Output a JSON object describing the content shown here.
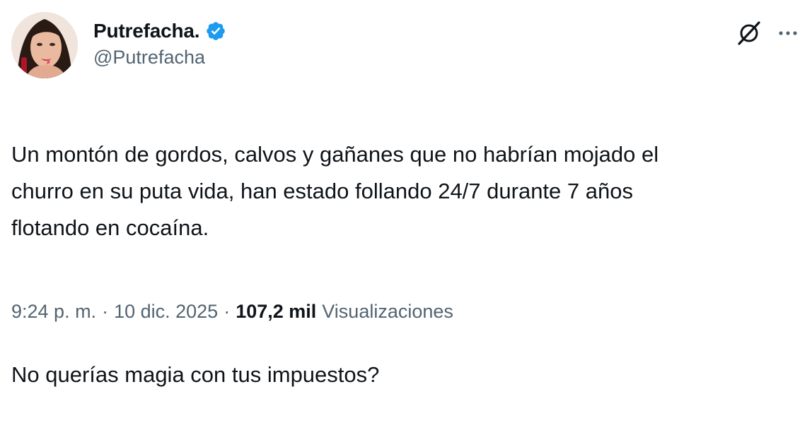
{
  "author": {
    "display_name": "Putrefacha.",
    "handle": "@Putrefacha",
    "verified": true,
    "verified_color": "#1d9bf0"
  },
  "tweet": {
    "paragraphs": [
      "Un montón de gordos, calvos y gañanes que no habrían mojado el\nchurro en su puta vida, han estado follando 24/7 durante 7 años\nflotando en cocaína.",
      "No querías magia con tus impuestos?"
    ]
  },
  "meta": {
    "time": "9:24 p. m.",
    "separator": "·",
    "date": "10 dic. 2025",
    "views_count": "107,2 mil",
    "views_label": "Visualizaciones"
  },
  "icons": {
    "verified": "verified-badge-icon",
    "grok": "grok-icon",
    "more": "more-horizontal-icon"
  },
  "colors": {
    "text_primary": "#0f1419",
    "text_secondary": "#536471",
    "accent": "#1d9bf0"
  }
}
